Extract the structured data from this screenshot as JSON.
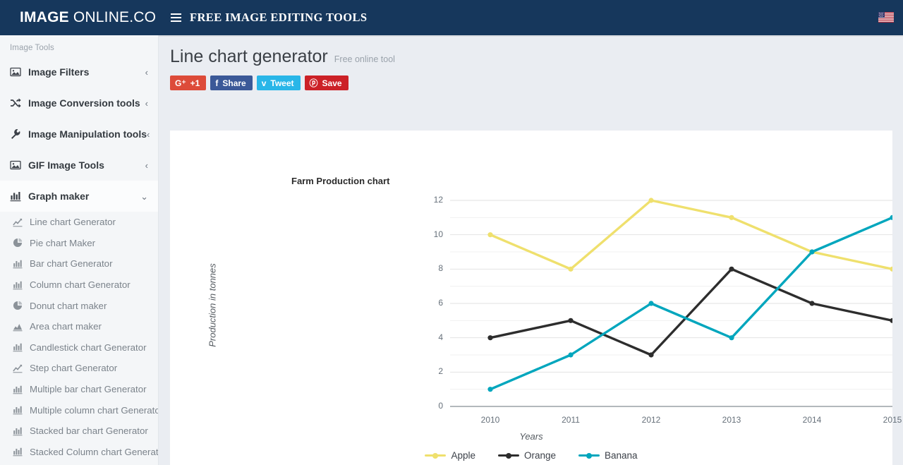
{
  "header": {
    "brand_strong": "IMAGE",
    "brand_light": " ONLINE.CO",
    "menu_icon": "hamburger-icon",
    "nav_title": "FREE IMAGE EDITING TOOLS",
    "flag_icon": "us-flag-icon",
    "background": "#16375c"
  },
  "sidebar": {
    "heading": "Image Tools",
    "groups": [
      {
        "label": "Image Filters",
        "icon": "image-icon",
        "chevron": "‹",
        "active": false
      },
      {
        "label": "Image Conversion tools",
        "icon": "shuffle-icon",
        "chevron": "‹",
        "active": false
      },
      {
        "label": "Image Manipulation tools",
        "icon": "wrench-icon",
        "chevron": "‹",
        "active": false
      },
      {
        "label": "GIF Image Tools",
        "icon": "image-icon",
        "chevron": "‹",
        "active": false
      },
      {
        "label": "Graph maker",
        "icon": "bar-chart-icon",
        "chevron": "⌄",
        "active": true
      }
    ],
    "sub_items": [
      {
        "label": "Line chart Generator",
        "icon": "line-chart-icon"
      },
      {
        "label": "Pie chart Maker",
        "icon": "pie-chart-icon"
      },
      {
        "label": "Bar chart Generator",
        "icon": "bar-chart-icon"
      },
      {
        "label": "Column chart Generator",
        "icon": "bar-chart-icon"
      },
      {
        "label": "Donut chart maker",
        "icon": "pie-chart-icon"
      },
      {
        "label": "Area chart maker",
        "icon": "area-chart-icon"
      },
      {
        "label": "Candlestick chart Generator",
        "icon": "bar-chart-icon"
      },
      {
        "label": "Step chart Generator",
        "icon": "line-chart-icon"
      },
      {
        "label": "Multiple bar chart Generator",
        "icon": "bar-chart-icon"
      },
      {
        "label": "Multiple column chart Generato",
        "icon": "bar-chart-icon"
      },
      {
        "label": "Stacked bar chart Generator",
        "icon": "bar-chart-icon"
      },
      {
        "label": "Stacked Column chart Generato",
        "icon": "bar-chart-icon"
      }
    ]
  },
  "page": {
    "title": "Line chart generator",
    "subtitle": "Free online tool"
  },
  "social": [
    {
      "label": "+1",
      "icon": "google-plus-icon",
      "glyph": "G⁺",
      "color": "#dd4b39",
      "key": "gplus"
    },
    {
      "label": "Share",
      "icon": "facebook-icon",
      "glyph": "f",
      "color": "#3b5998",
      "key": "fb"
    },
    {
      "label": "Tweet",
      "icon": "twitter-icon",
      "glyph": "ᴠ",
      "color": "#29b6e8",
      "key": "tw"
    },
    {
      "label": "Save",
      "icon": "pinterest-icon",
      "glyph": "ⓟ",
      "color": "#cc2127",
      "key": "pin"
    }
  ],
  "chart_data": {
    "type": "line",
    "title": "Farm Production chart",
    "xlabel": "Years",
    "ylabel": "Production in tonnes",
    "categories": [
      "2010",
      "2011",
      "2012",
      "2013",
      "2014",
      "2015"
    ],
    "ylim": [
      0,
      12
    ],
    "yticks": [
      0,
      2,
      4,
      6,
      8,
      10,
      12
    ],
    "minor_gridlines": [
      1,
      3,
      5,
      7,
      9,
      11
    ],
    "grid": true,
    "legend_position": "bottom",
    "series": [
      {
        "name": "Apple",
        "color": "#efe06d",
        "values": [
          10,
          8,
          12,
          11,
          9,
          8
        ]
      },
      {
        "name": "Orange",
        "color": "#2d2d2d",
        "values": [
          4,
          5,
          3,
          8,
          6,
          5
        ]
      },
      {
        "name": "Banana",
        "color": "#00a6bd",
        "values": [
          1,
          3,
          6,
          4,
          9,
          11
        ]
      }
    ]
  }
}
